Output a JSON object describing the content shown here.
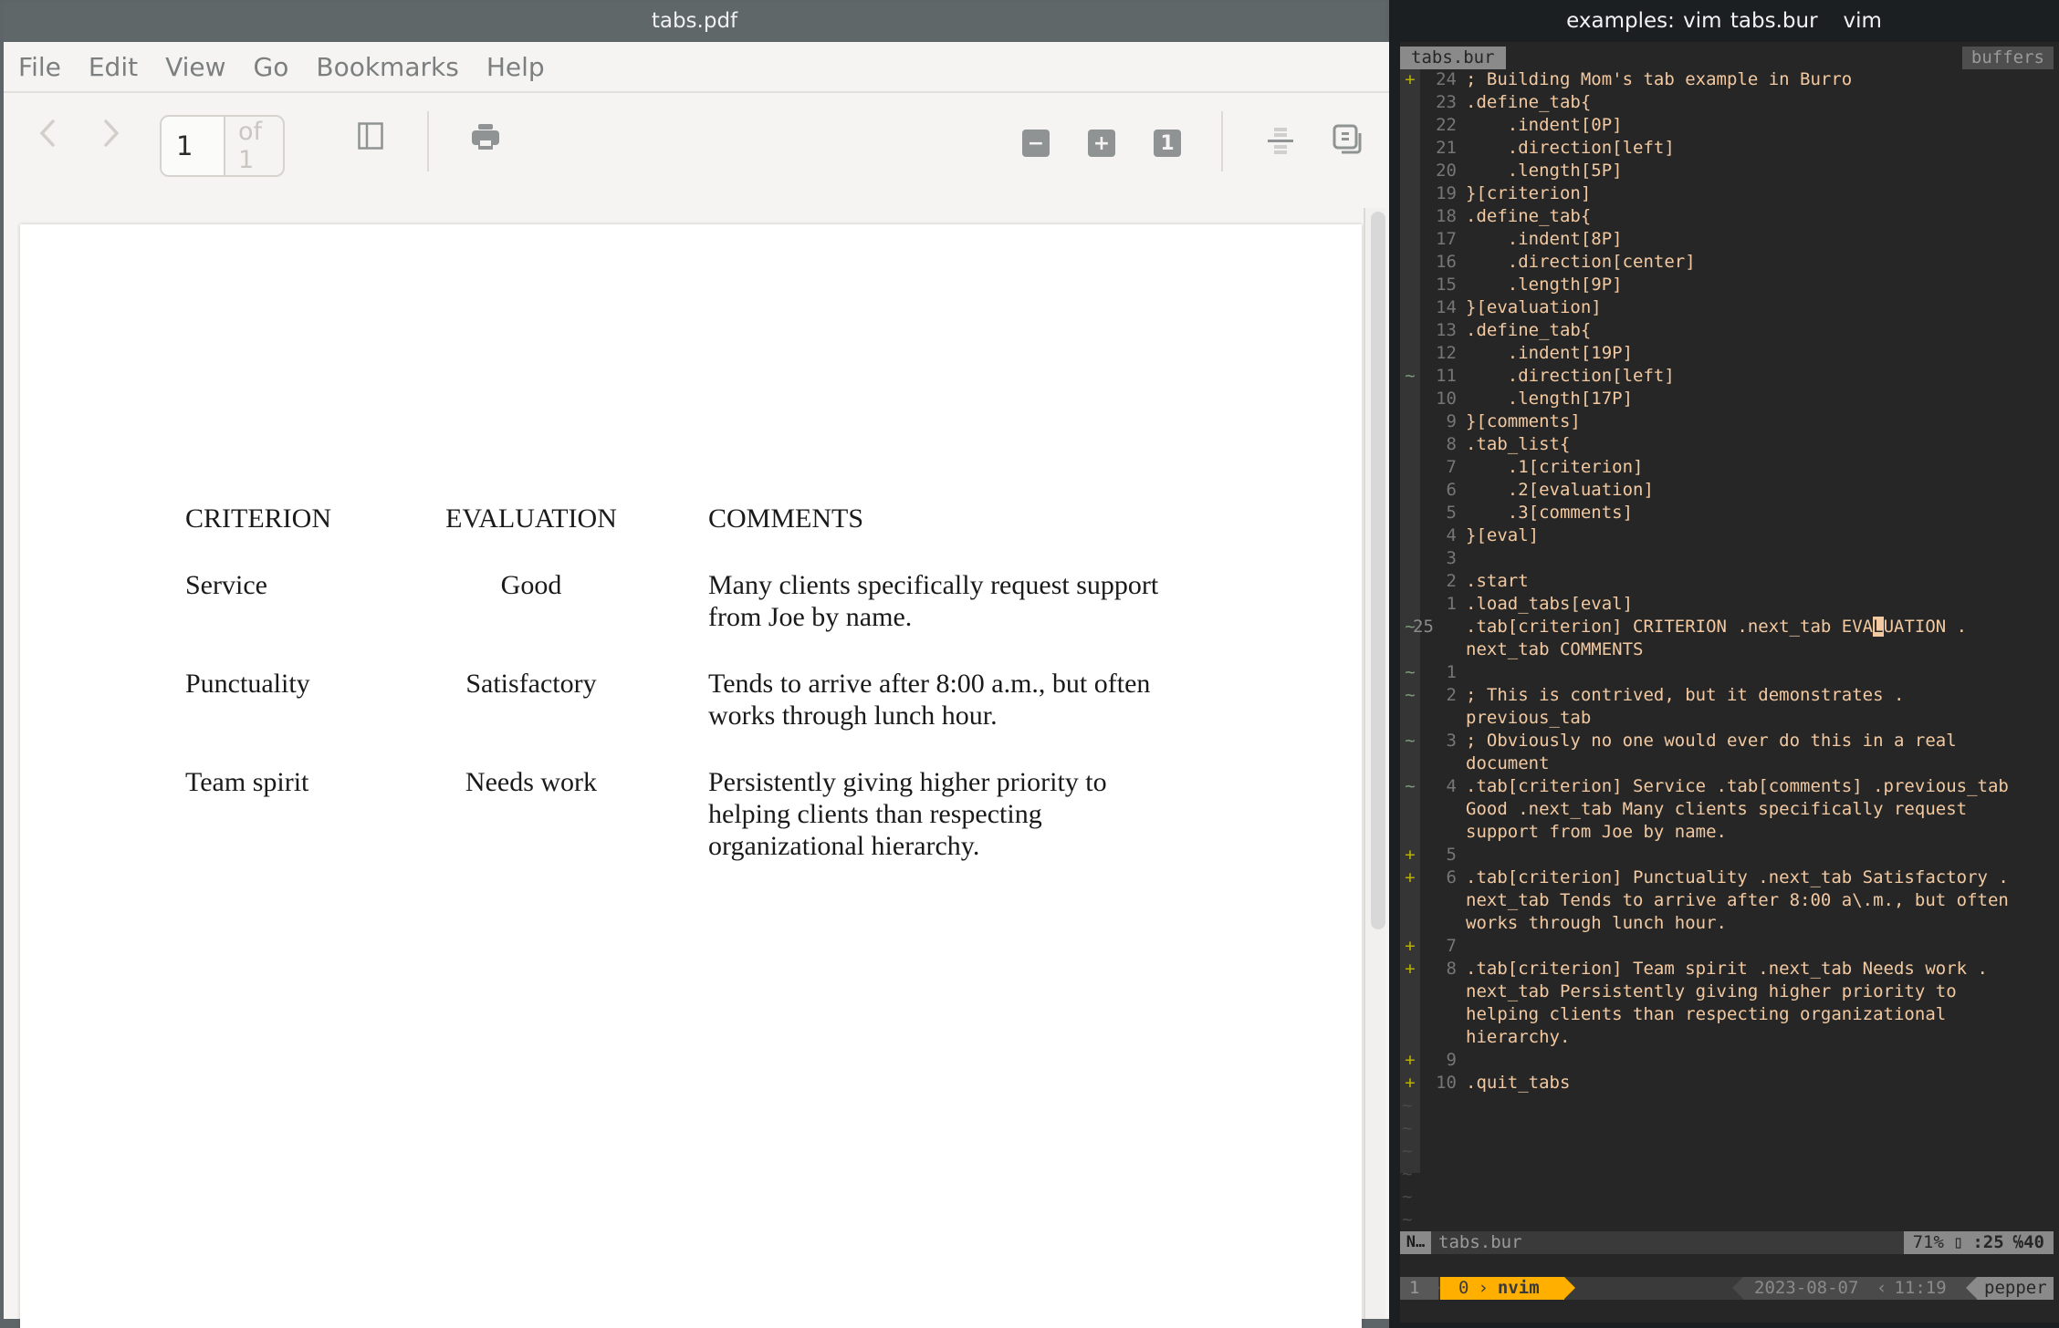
{
  "pdf_window": {
    "title": "tabs.pdf",
    "menu": [
      "File",
      "Edit",
      "View",
      "Go",
      "Bookmarks",
      "Help"
    ],
    "toolbar": {
      "prev_icon": "‹",
      "next_icon": "›",
      "page_current": "1",
      "page_of": "of 1",
      "zoom_out_glyph": "−",
      "zoom_in_glyph": "+",
      "zoom_reset_glyph": "1"
    },
    "scroll_fraction_visible": 0.65,
    "document": {
      "headers": [
        "CRITERION",
        "EVALUATION",
        "COMMENTS"
      ],
      "rows": [
        {
          "criterion": "Service",
          "evaluation": "Good",
          "comments": [
            "Many clients specifically request support",
            "from Joe by name."
          ]
        },
        {
          "criterion": "Punctuality",
          "evaluation": "Satisfactory",
          "comments": [
            "Tends to arrive after 8:00 a.m., but often",
            "works through lunch hour."
          ]
        },
        {
          "criterion": "Team spirit",
          "evaluation": "Needs work",
          "comments": [
            "Persistently giving higher priority to",
            "helping clients than respecting",
            "organizational hierarchy."
          ]
        }
      ]
    }
  },
  "vim_window": {
    "title": "examples: vim tabs.bur   vim",
    "tabline": {
      "active_tab": "tabs.bur",
      "right_label": "buffers"
    },
    "lines": [
      {
        "sign": "+",
        "num": "24",
        "text": "; Building Mom's tab example in Burro"
      },
      {
        "sign": "",
        "num": "23",
        "text": ".define_tab{"
      },
      {
        "sign": "",
        "num": "22",
        "text": "    .indent[0P]"
      },
      {
        "sign": "",
        "num": "21",
        "text": "    .direction[left]"
      },
      {
        "sign": "",
        "num": "20",
        "text": "    .length[5P]"
      },
      {
        "sign": "",
        "num": "19",
        "text": "}[criterion]"
      },
      {
        "sign": "",
        "num": "18",
        "text": ".define_tab{"
      },
      {
        "sign": "",
        "num": "17",
        "text": "    .indent[8P]"
      },
      {
        "sign": "",
        "num": "16",
        "text": "    .direction[center]"
      },
      {
        "sign": "",
        "num": "15",
        "text": "    .length[9P]"
      },
      {
        "sign": "",
        "num": "14",
        "text": "}[evaluation]"
      },
      {
        "sign": "",
        "num": "13",
        "text": ".define_tab{"
      },
      {
        "sign": "",
        "num": "12",
        "text": "    .indent[19P]"
      },
      {
        "sign": "~",
        "num": "11",
        "text": "    .direction[left]"
      },
      {
        "sign": "",
        "num": "10",
        "text": "    .length[17P]"
      },
      {
        "sign": "",
        "num": "9",
        "text": "}[comments]"
      },
      {
        "sign": "",
        "num": "8",
        "text": ".tab_list{"
      },
      {
        "sign": "",
        "num": "7",
        "text": "    .1[criterion]"
      },
      {
        "sign": "",
        "num": "6",
        "text": "    .2[evaluation]"
      },
      {
        "sign": "",
        "num": "5",
        "text": "    .3[comments]"
      },
      {
        "sign": "",
        "num": "4",
        "text": "}[eval]"
      },
      {
        "sign": "",
        "num": "3",
        "text": ""
      },
      {
        "sign": "",
        "num": "2",
        "text": ".start"
      },
      {
        "sign": "",
        "num": "1",
        "text": ".load_tabs[eval]"
      },
      {
        "sign": "~",
        "num": "25",
        "current": true,
        "text_before_cursor": ".tab[criterion] CRITERION .next_tab EVA",
        "cursor_char": "L",
        "text_after_cursor": "UATION ."
      },
      {
        "sign": "",
        "num": "",
        "text": "next_tab COMMENTS"
      },
      {
        "sign": "~",
        "num": "1",
        "text": ""
      },
      {
        "sign": "~",
        "num": "2",
        "text": "; This is contrived, but it demonstrates ."
      },
      {
        "sign": "",
        "num": "",
        "text": "previous_tab"
      },
      {
        "sign": "~",
        "num": "3",
        "text": "; Obviously no one would ever do this in a real"
      },
      {
        "sign": "",
        "num": "",
        "text": "document"
      },
      {
        "sign": "~",
        "num": "4",
        "text": ".tab[criterion] Service .tab[comments] .previous_tab"
      },
      {
        "sign": "",
        "num": "",
        "text": "Good .next_tab Many clients specifically request"
      },
      {
        "sign": "",
        "num": "",
        "text": "support from Joe by name."
      },
      {
        "sign": "+",
        "num": "5",
        "text": ""
      },
      {
        "sign": "+",
        "num": "6",
        "text": ".tab[criterion] Punctuality .next_tab Satisfactory ."
      },
      {
        "sign": "",
        "num": "",
        "text": "next_tab Tends to arrive after 8:00 a\\.m., but often"
      },
      {
        "sign": "",
        "num": "",
        "text": "works through lunch hour."
      },
      {
        "sign": "+",
        "num": "7",
        "text": ""
      },
      {
        "sign": "+",
        "num": "8",
        "text": ".tab[criterion] Team spirit .next_tab Needs work ."
      },
      {
        "sign": "",
        "num": "",
        "text": "next_tab Persistently giving higher priority to"
      },
      {
        "sign": "",
        "num": "",
        "text": "helping clients than respecting organizational"
      },
      {
        "sign": "",
        "num": "",
        "text": "hierarchy."
      },
      {
        "sign": "+",
        "num": "9",
        "text": ""
      },
      {
        "sign": "+",
        "num": "10",
        "text": ".quit_tabs"
      }
    ],
    "end_of_buffer_marker": "~",
    "end_of_buffer_count": 6,
    "statusline": {
      "mode": "N…",
      "file": "tabs.bur",
      "percent": "71%",
      "glyph": "▯",
      "line": ":25",
      "col": "℅40"
    },
    "tmux": {
      "session": "1",
      "window_index": "0",
      "window_name": "nvim",
      "date": "2023-08-07",
      "time": "11:19",
      "host": "pepper"
    },
    "colors": {
      "code_fg": "#f2c9a1",
      "accent_tmux": "#ffaf00",
      "git_added": "#b8b000",
      "git_changed": "#7c9a7c"
    }
  }
}
